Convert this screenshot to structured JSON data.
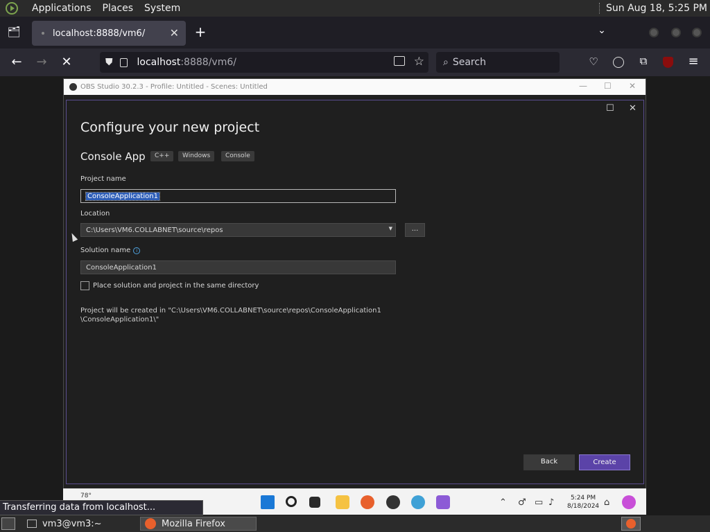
{
  "gnome_top": {
    "menus": [
      "Applications",
      "Places",
      "System"
    ],
    "clock": "Sun Aug 18,  5:25 PM"
  },
  "firefox": {
    "tab_title": "localhost:8888/vm6/",
    "url_host": "localhost",
    "url_rest": ":8888/vm6/",
    "search_placeholder": "Search",
    "status": "Transferring data from localhost..."
  },
  "obs": {
    "title": "OBS Studio 30.2.3 - Profile: Untitled - Scenes: Untitled"
  },
  "vs_dialog": {
    "heading": "Configure your new project",
    "app_name": "Console App",
    "tags": [
      "C++",
      "Windows",
      "Console"
    ],
    "project_name_label": "Project name",
    "project_name": "ConsoleApplication1",
    "location_label": "Location",
    "location": "C:\\Users\\VM6.COLLABNET\\source\\repos",
    "browse_label": "...",
    "solution_label": "Solution name",
    "solution_name": "ConsoleApplication1",
    "same_dir_label": "Place solution and project in the same directory",
    "note": "Project will be created in \"C:\\Users\\VM6.COLLABNET\\source\\repos\\ConsoleApplication1\n\\ConsoleApplication1\\\"",
    "back_label": "Back",
    "create_label": "Create",
    "accent": "#5b43a8"
  },
  "win_taskbar": {
    "weather": "78°",
    "time": "5:24 PM",
    "date": "8/18/2024"
  },
  "gnome_bottom": {
    "tasks": [
      "vm3@vm3:~",
      "Mozilla Firefox"
    ]
  }
}
